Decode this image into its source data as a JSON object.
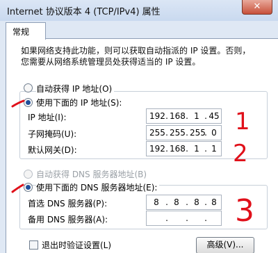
{
  "window": {
    "title": "Internet 协议版本 4 (TCP/IPv4) 属性",
    "close_label": "✕"
  },
  "tabs": [
    {
      "label": "常规"
    }
  ],
  "description": {
    "line1": "如果网络支持此功能，则可以获取自动指派的 IP 设置。否则，",
    "line2": "您需要从网络系统管理员处获得适当的 IP 设置。"
  },
  "ip_mode": {
    "auto_label": "自动获得 IP 地址(O)",
    "manual_label": "使用下面的 IP 地址(S):"
  },
  "ip_fields": {
    "ip_label": "IP 地址(I):",
    "ip_value": [
      "192",
      "168",
      "1",
      "45"
    ],
    "mask_label": "子网掩码(U):",
    "mask_value": [
      "255",
      "255",
      "255",
      "0"
    ],
    "gateway_label": "默认网关(D):",
    "gateway_value": [
      "192",
      "168",
      "1",
      "1"
    ]
  },
  "dns_mode": {
    "auto_label": "自动获得 DNS 服务器地址(B)",
    "manual_label": "使用下面的 DNS 服务器地址(E):"
  },
  "dns_fields": {
    "preferred_label": "首选 DNS 服务器(P):",
    "preferred_value": [
      "8",
      "8",
      "8",
      "8"
    ],
    "alternate_label": "备用 DNS 服务器(A):",
    "alternate_value": [
      ".",
      ".",
      "."
    ]
  },
  "footer": {
    "validate_label": "退出时验证设置(L)",
    "advanced_button": "高级(V)..."
  },
  "annotations": {
    "mark_1": "1",
    "mark_2": "2",
    "mark_3": "3",
    "ink_color": "#e0101a"
  }
}
